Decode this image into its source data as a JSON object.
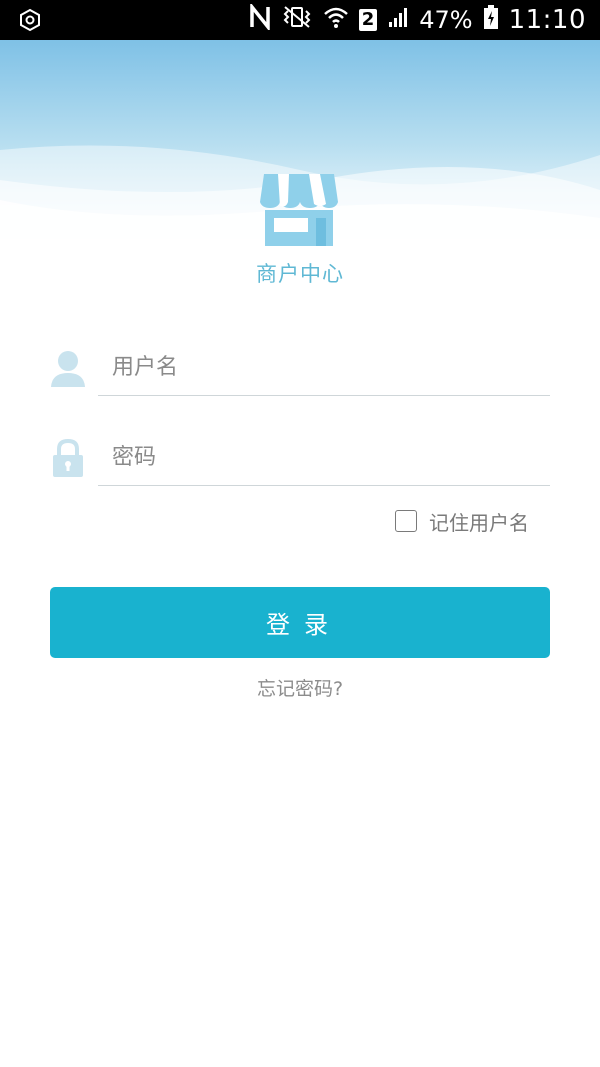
{
  "status_bar": {
    "battery": "47%",
    "time": "11:10",
    "sim_slot": "2",
    "icons": [
      "settings-icon",
      "nfc-icon",
      "vibrate-icon",
      "wifi-icon",
      "signal-icon",
      "battery-icon"
    ]
  },
  "app": {
    "title": "商户中心",
    "logo_icon": "storefront-icon",
    "accent_color": "#19b2cf"
  },
  "form": {
    "username_placeholder": "用户名",
    "username_value": "",
    "password_placeholder": "密码",
    "password_value": "",
    "remember_label": "记住用户名",
    "remember_checked": false,
    "login_label": "登录",
    "forgot_label": "忘记密码?"
  }
}
